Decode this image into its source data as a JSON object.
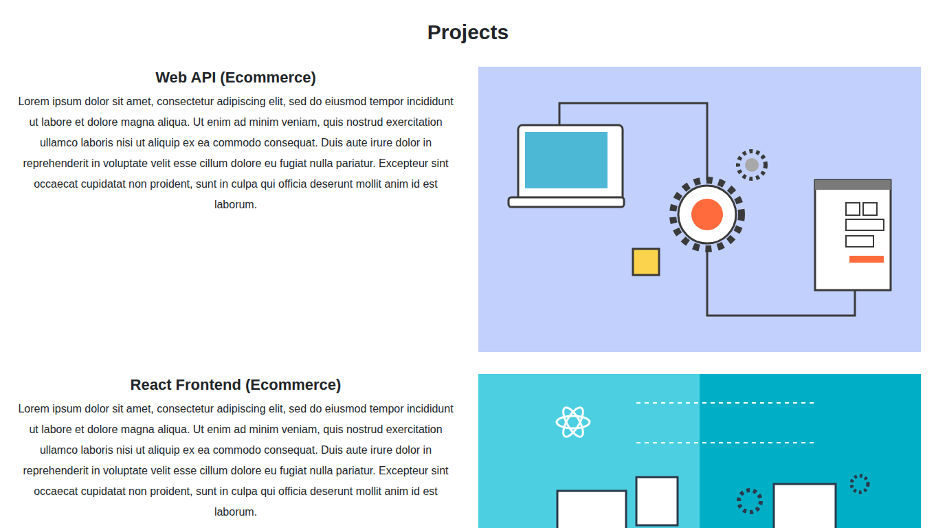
{
  "page": {
    "heading": "Projects"
  },
  "projects": [
    {
      "title": "Web API (Ecommerce)",
      "description": "Lorem ipsum dolor sit amet, consectetur adipiscing elit, sed do eiusmod tempor incididunt ut labore et dolore magna aliqua. Ut enim ad minim veniam, quis nostrud exercitation ullamco laboris nisi ut aliquip ex ea commodo consequat. Duis aute irure dolor in reprehenderit in voluptate velit esse cillum dolore eu fugiat nulla pariatur. Excepteur sint occaecat cupidatat non proident, sunt in culpa qui officia deserunt mollit anim id est laborum.",
      "kind": "api"
    },
    {
      "title": "React Frontend (Ecommerce)",
      "description": "Lorem ipsum dolor sit amet, consectetur adipiscing elit, sed do eiusmod tempor incididunt ut labore et dolore magna aliqua. Ut enim ad minim veniam, quis nostrud exercitation ullamco laboris nisi ut aliquip ex ea commodo consequat. Duis aute irure dolor in reprehenderit in voluptate velit esse cillum dolore eu fugiat nulla pariatur. Excepteur sint occaecat cupidatat non proident, sunt in culpa qui officia deserunt mollit anim id est laborum.",
      "kind": "react"
    }
  ]
}
